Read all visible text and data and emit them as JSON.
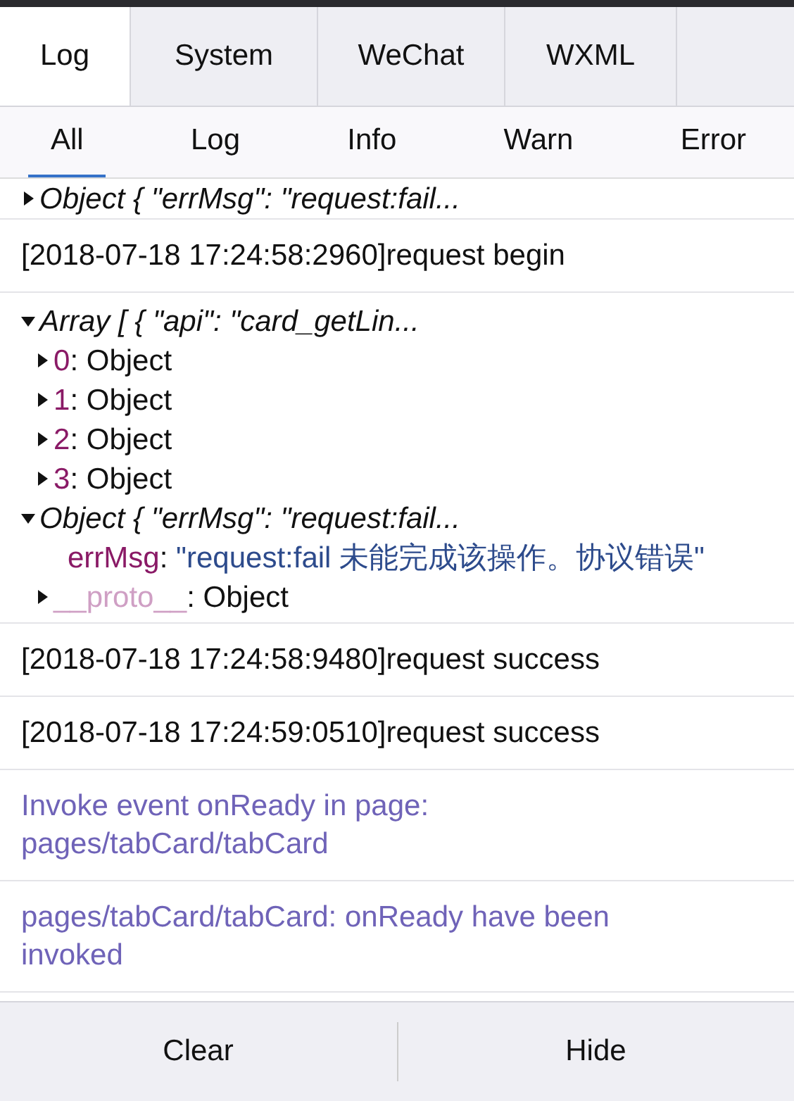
{
  "tabs": [
    {
      "label": "Log",
      "selected": true
    },
    {
      "label": "System",
      "selected": false
    },
    {
      "label": "WeChat",
      "selected": false
    },
    {
      "label": "WXML",
      "selected": false
    }
  ],
  "filters": [
    {
      "label": "All",
      "selected": true
    },
    {
      "label": "Log",
      "selected": false
    },
    {
      "label": "Info",
      "selected": false
    },
    {
      "label": "Warn",
      "selected": false
    },
    {
      "label": "Error",
      "selected": false
    }
  ],
  "entries": [
    {
      "kind": "tree",
      "nodes": [
        {
          "summary": "Object { \"errMsg\": \"request:fail...",
          "expanded": false
        }
      ]
    },
    {
      "kind": "log",
      "text": "[2018-07-18 17:24:58:2960]request begin"
    },
    {
      "kind": "tree",
      "nodes": [
        {
          "summary": "Array [ { \"api\": \"card_getLin...",
          "expanded": true,
          "children": [
            {
              "key": "0:",
              "value": "Object",
              "kind": "object",
              "dim": false,
              "expanded": false
            },
            {
              "key": "1:",
              "value": "Object",
              "kind": "object",
              "dim": false,
              "expanded": false
            },
            {
              "key": "2:",
              "value": "Object",
              "kind": "object",
              "dim": false,
              "expanded": false
            },
            {
              "key": "3:",
              "value": "Object",
              "kind": "object",
              "dim": false,
              "expanded": false
            }
          ]
        },
        {
          "summary": "Object { \"errMsg\": \"request:fail...",
          "expanded": true,
          "children": [
            {
              "key": "errMsg:",
              "value": "\"request:fail 未能完成该操作。协议错误\"",
              "kind": "string",
              "dim": false
            },
            {
              "key": "__proto__:",
              "value": "Object",
              "kind": "object",
              "dim": true,
              "expanded": false
            }
          ]
        }
      ]
    },
    {
      "kind": "log",
      "text": "[2018-07-18 17:24:58:9480]request success"
    },
    {
      "kind": "log",
      "text": "[2018-07-18 17:24:59:0510]request success"
    },
    {
      "kind": "info",
      "text": "Invoke event onReady in page: pages/tabCard/tabCard"
    },
    {
      "kind": "info",
      "text": "pages/tabCard/tabCard: onReady have been invoked"
    }
  ],
  "buttons": [
    {
      "label": "Clear"
    },
    {
      "label": "Hide"
    }
  ]
}
